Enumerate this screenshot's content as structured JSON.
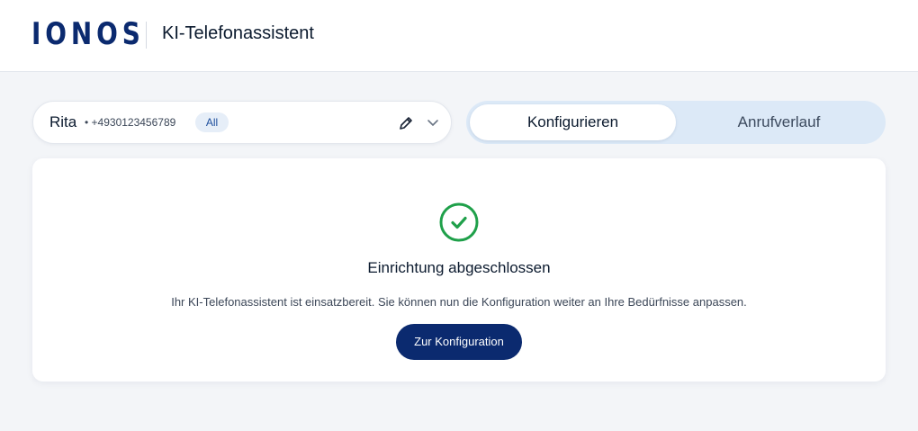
{
  "header": {
    "logo_text": "IONOS",
    "app_title": "KI-Telefonassistent"
  },
  "assistant_selector": {
    "name": "Rita",
    "number": "• +4930123456789",
    "badge": "All",
    "edit_icon": "pencil-icon",
    "dropdown_icon": "chevron-down-icon"
  },
  "tabs": [
    {
      "label": "Konfigurieren",
      "active": true
    },
    {
      "label": "Anrufverlauf",
      "active": false
    }
  ],
  "status_card": {
    "icon": "check-circle-icon",
    "title": "Einrichtung abgeschlossen",
    "text": "Ihr KI-Telefonassistent ist einsatzbereit. Sie können nun die Konfiguration weiter an Ihre Bedürfnisse anpassen.",
    "button_label": "Zur Konfiguration"
  },
  "colors": {
    "brand": "#0b2a6f",
    "success": "#1fa04a",
    "background": "#f3f5f8",
    "tab_track": "#dce9f7"
  }
}
